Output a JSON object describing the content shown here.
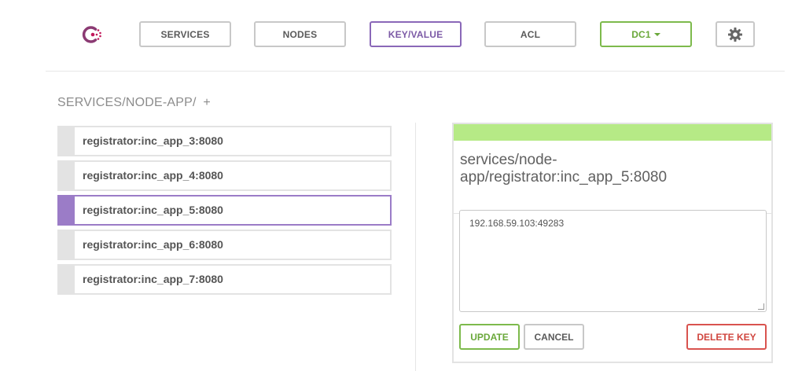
{
  "nav": {
    "items": [
      {
        "label": "SERVICES"
      },
      {
        "label": "NODES"
      },
      {
        "label": "KEY/VALUE"
      },
      {
        "label": "ACL"
      }
    ],
    "datacenter": "DC1",
    "icons": {
      "logo": "consul-logo-icon",
      "settings": "gear-icon",
      "dropdown": "caret-down-icon"
    },
    "colors": {
      "accent": "#8a68b8",
      "success": "#7dba4c",
      "danger": "#d9534f"
    }
  },
  "breadcrumb": {
    "path": "SERVICES/NODE-APP/",
    "add": "+"
  },
  "keys": [
    {
      "label": "registrator:inc_app_3:8080"
    },
    {
      "label": "registrator:inc_app_4:8080"
    },
    {
      "label": "registrator:inc_app_5:8080"
    },
    {
      "label": "registrator:inc_app_6:8080"
    },
    {
      "label": "registrator:inc_app_7:8080"
    }
  ],
  "selected_key": "registrator:inc_app_5:8080",
  "editor": {
    "title_line1": "services/node-",
    "title_line2": "app/registrator:inc_app_5:8080",
    "value": "192.168.59.103:49283",
    "update": "UPDATE",
    "cancel": "CANCEL",
    "delete": "DELETE KEY"
  }
}
